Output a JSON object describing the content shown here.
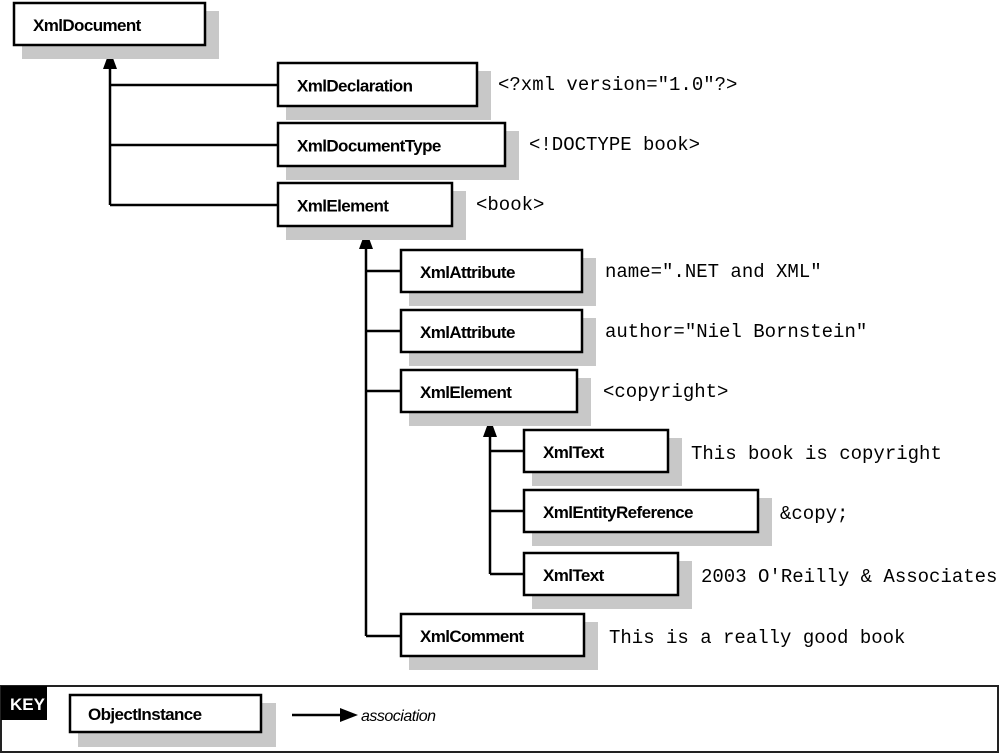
{
  "nodes": {
    "doc": {
      "label": "XmlDocument"
    },
    "decl": {
      "label": "XmlDeclaration",
      "xml": "<?xml version=\"1.0\"?>"
    },
    "doctype": {
      "label": "XmlDocumentType",
      "xml": "<!DOCTYPE book>"
    },
    "book": {
      "label": "XmlElement",
      "xml": "<book>"
    },
    "attr1": {
      "label": "XmlAttribute",
      "xml": "name=\".NET and XML\""
    },
    "attr2": {
      "label": "XmlAttribute",
      "xml": "author=\"Niel Bornstein\""
    },
    "copyright": {
      "label": "XmlElement",
      "xml": "<copyright>"
    },
    "text1": {
      "label": "XmlText",
      "xml": "This book is copyright"
    },
    "entity": {
      "label": "XmlEntityReference",
      "xml": "&copy;"
    },
    "text2": {
      "label": "XmlText",
      "xml": "2003 O'Reilly & Associates"
    },
    "comment": {
      "label": "XmlComment",
      "xml": "This is a really good book"
    }
  },
  "key": {
    "title": "KEY",
    "instance": "ObjectInstance",
    "association": "association"
  }
}
